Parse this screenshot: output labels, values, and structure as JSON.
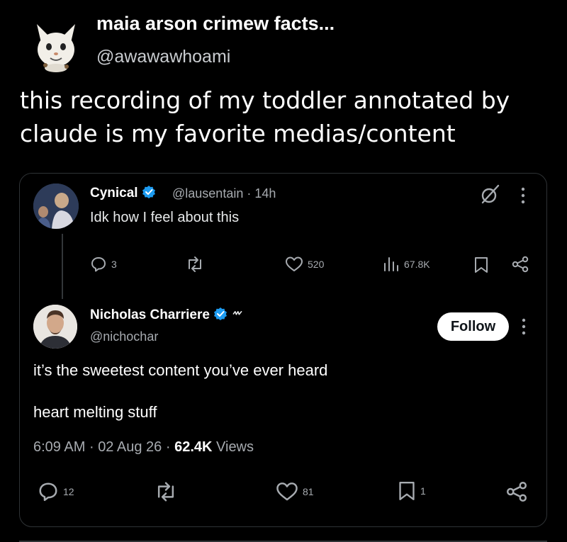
{
  "outer_post": {
    "display_name": "maia arson crimew facts...",
    "handle": "@awawawhoami",
    "text": "this recording of my toddler annotated by claude is my favorite medias/content",
    "avatar_icon": "cat-avatar-icon"
  },
  "quoted_post": {
    "display_name": "Cynical",
    "handle": "@lausentain",
    "separator": "·",
    "time": "14h",
    "text": "Idk how I feel about this",
    "verified_color": "#1d9bf0",
    "actions": {
      "replies": "3",
      "likes": "520",
      "views": "67.8K"
    }
  },
  "reply_post": {
    "display_name": "Nicholas Charriere",
    "handle": "@nichochar",
    "follow_label": "Follow",
    "line1": "it’s the sweetest content you’ve ever heard",
    "line2": "heart melting stuff",
    "time": "6:09 AM",
    "sep1": "·",
    "date": "02 Aug 26",
    "sep2": "·",
    "views_count": "62.4K",
    "views_label": "Views",
    "actions": {
      "replies": "12",
      "likes": "81",
      "bookmarks": "1"
    }
  },
  "colors": {
    "background": "#000000",
    "text": "#e7e9ea",
    "secondary": "#a7abb0",
    "verified": "#1d9bf0",
    "border": "#2f3336"
  }
}
